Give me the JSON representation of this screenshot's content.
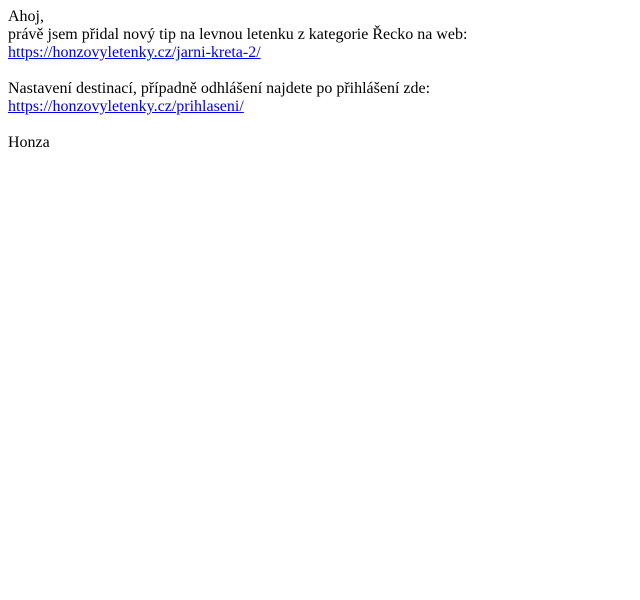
{
  "email": {
    "greeting": "Ahoj,",
    "intro": "právě jsem přidal nový tip na levnou letenku z kategorie Řecko na web:",
    "tip_link": "https://honzovyletenky.cz/jarni-kreta-2/",
    "settings_text": "Nastavení destinací, případně odhlášení najdete po přihlášení zde:",
    "login_link": "https://honzovyletenky.cz/prihlaseni/",
    "signature": "Honza"
  },
  "colors": {
    "text": "#000000",
    "link": "#0000ee",
    "background": "#ffffff"
  }
}
